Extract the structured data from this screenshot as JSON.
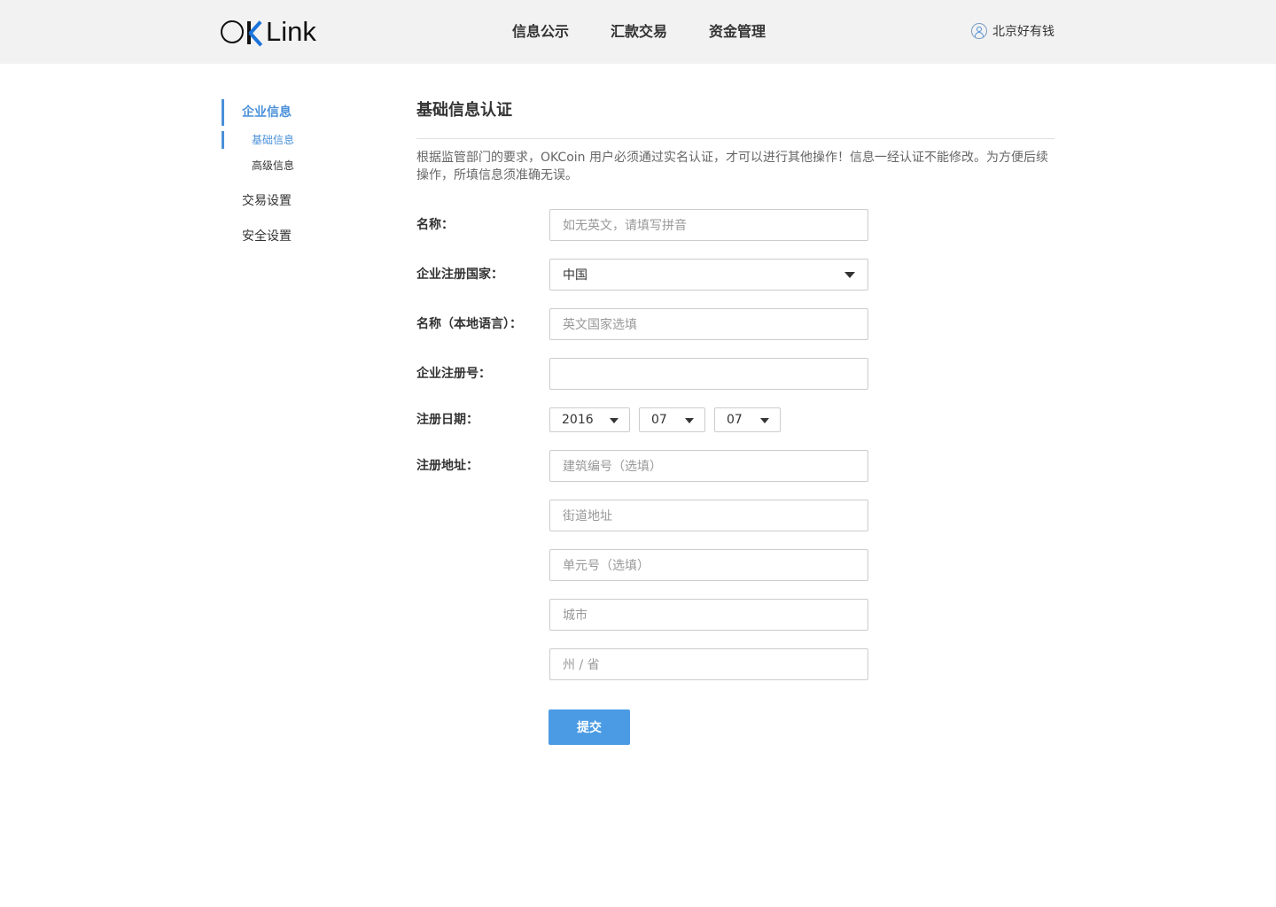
{
  "header": {
    "logo_text": "OKLink",
    "nav": [
      "信息公示",
      "汇款交易",
      "资金管理"
    ],
    "user_name": "北京好有钱"
  },
  "sidebar": {
    "groups": [
      {
        "label": "企业信息",
        "active": true,
        "subitems": [
          {
            "label": "基础信息",
            "active": true
          },
          {
            "label": "高级信息",
            "active": false
          }
        ]
      },
      {
        "label": "交易设置",
        "active": false
      },
      {
        "label": "安全设置",
        "active": false
      }
    ]
  },
  "main": {
    "title": "基础信息认证",
    "notice": "根据监管部门的要求，OKCoin 用户必须通过实名认证，才可以进行其他操作！信息一经认证不能修改。为方便后续操作，所填信息须准确无误。",
    "form": {
      "name": {
        "label": "名称：",
        "value": "",
        "placeholder": "如无英文，请填写拼音"
      },
      "country": {
        "label": "企业注册国家：",
        "value": "中国"
      },
      "local_name": {
        "label": "名称（本地语言）：",
        "value": "",
        "placeholder": "英文国家选填"
      },
      "reg_number": {
        "label": "企业注册号：",
        "value": "",
        "placeholder": ""
      },
      "reg_date": {
        "label": "注册日期：",
        "year": "2016",
        "month": "07",
        "day": "07"
      },
      "address": {
        "label": "注册地址：",
        "building": {
          "placeholder": "建筑编号（选填）"
        },
        "street": {
          "placeholder": "街道地址"
        },
        "unit": {
          "placeholder": "单元号（选填）"
        },
        "city": {
          "placeholder": "城市"
        },
        "state": {
          "placeholder": "州 / 省"
        }
      },
      "submit_label": "提交"
    }
  },
  "colors": {
    "accent": "#4a90d9",
    "button": "#4a9be4",
    "header_bg": "#f2f2f2",
    "logo_k": "#1a73d9"
  }
}
